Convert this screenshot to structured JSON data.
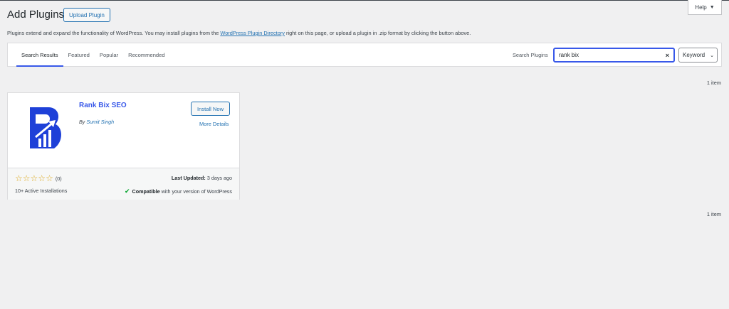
{
  "help": {
    "label": "Help",
    "caret": "▼"
  },
  "page": {
    "title": "Add Plugins",
    "upload_label": "Upload Plugin",
    "intro_before": "Plugins extend and expand the functionality of WordPress. You may install plugins from the ",
    "intro_link": "WordPress Plugin Directory",
    "intro_after": " right on this page, or upload a plugin in .zip format by clicking the button above."
  },
  "filter": {
    "tabs": [
      "Search Results",
      "Featured",
      "Popular",
      "Recommended"
    ],
    "search_label": "Search Plugins",
    "search_value": "rank bix",
    "clear_icon": "×",
    "type_value": "Keyword",
    "type_caret": "⌄"
  },
  "results": {
    "count_top": "1 item",
    "count_bottom": "1 item"
  },
  "plugin": {
    "name": "Rank Bix SEO",
    "author_prefix": "By ",
    "author": "Sumit Singh",
    "install_label": "Install Now",
    "more_details": "More Details",
    "stars": [
      "☆",
      "☆",
      "☆",
      "☆",
      "☆"
    ],
    "rating_count": "(0)",
    "installs": "10+ Active Installations",
    "updated_label": "Last Updated:",
    "updated_value": " 3 days ago",
    "compat_label": "Compatible",
    "compat_rest": " with your version of WordPress",
    "check_icon": "✔",
    "icon_colors": {
      "primary": "#1e40d8",
      "secondary": "#ffffff"
    }
  },
  "colors": {
    "accent": "#3858e9",
    "link": "#2271b1",
    "star": "#dba617",
    "ok": "#00a32a"
  }
}
